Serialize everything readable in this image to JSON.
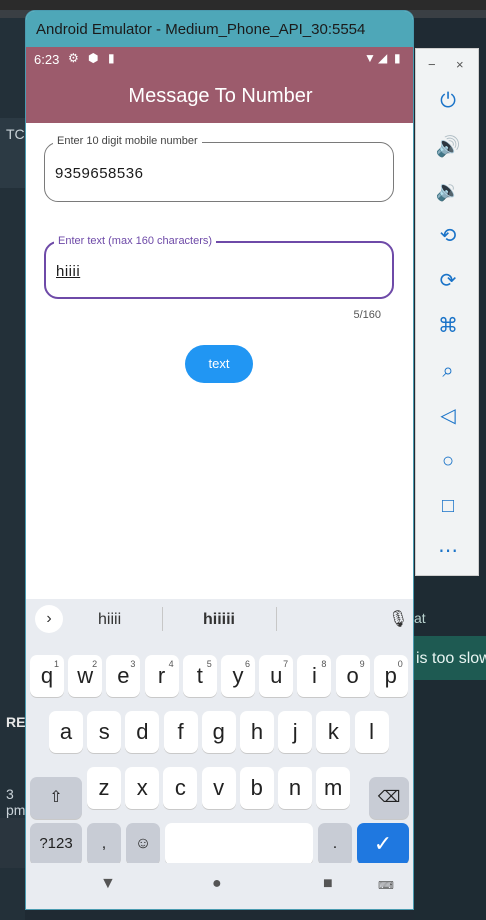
{
  "window": {
    "title": "Android Emulator - Medium_Phone_API_30:5554"
  },
  "status_bar": {
    "time": "6:23"
  },
  "app": {
    "title": "Message To Number",
    "phone_field": {
      "label": "Enter 10 digit mobile number",
      "value": "9359658536"
    },
    "text_field": {
      "label": "Enter text (max 160 characters)",
      "value": "hiiii"
    },
    "counter": "5/160",
    "button_label": "text"
  },
  "keyboard": {
    "suggestions": [
      "hiiii",
      "hiiiii"
    ],
    "row1": [
      "q",
      "w",
      "e",
      "r",
      "t",
      "y",
      "u",
      "i",
      "o",
      "p"
    ],
    "row1_hints": [
      "1",
      "2",
      "3",
      "4",
      "5",
      "6",
      "7",
      "8",
      "9",
      "0"
    ],
    "row2": [
      "a",
      "s",
      "d",
      "f",
      "g",
      "h",
      "j",
      "k",
      "l"
    ],
    "row3": [
      "z",
      "x",
      "c",
      "v",
      "b",
      "n",
      "m"
    ],
    "symbols_label": "?123",
    "comma": ",",
    "period": "."
  },
  "background": {
    "left_partial": "TC",
    "left_partial2": "READ",
    "left_partial3": "3 pm",
    "right_partial": "at",
    "right_partial2": "is too slow"
  },
  "side_panel": {
    "minimize": "−",
    "close": "×"
  },
  "icons": {
    "power": "power-icon",
    "volume_up": "volume-up-icon",
    "volume_down": "volume-down-icon",
    "rotate_left": "rotate-left-icon",
    "rotate_right": "rotate-right-icon",
    "camera": "camera-icon",
    "zoom": "zoom-icon",
    "back": "back-icon",
    "home": "home-icon",
    "overview": "overview-icon",
    "more": "more-icon"
  },
  "colors": {
    "app_bar": "#9c5b6c",
    "accent": "#6e4aa8",
    "button": "#2196f3",
    "title_bar": "#4ea7b8"
  }
}
